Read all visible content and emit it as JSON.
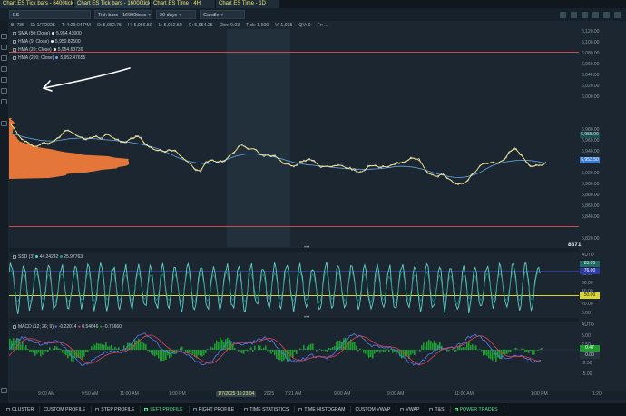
{
  "tabs": [
    {
      "label": "Chart ES Tick bars - 6400ticks"
    },
    {
      "label": "Chart ES Tick bars - 16000ticks"
    },
    {
      "label": "Chart ES Time - 4H"
    },
    {
      "label": "Chart ES Time - 1D"
    }
  ],
  "toolbar": {
    "symbol": "ES",
    "bar_type": "Tick bars - 16000ticks",
    "range": "20 days",
    "style": "Candle"
  },
  "info": {
    "bar_no": "B: 735",
    "date": "D: 1/7/2025",
    "time": "T: 4:23:04 PM",
    "open": "O: 5,952.75",
    "high": "H: 5,956.50",
    "low": "L: 5,952.50",
    "close": "C: 5,954.25",
    "change": "Chn: 0.03",
    "ticks": "Tick: 1,600",
    "volume": "V: 1,935",
    "qv": "QV: 0",
    "fr": "Fr: ..."
  },
  "legend": [
    {
      "name": "SMA (50;Close)",
      "value": "5,954.43000",
      "color": "#e7ecef"
    },
    {
      "name": "HMA (9; Close)",
      "value": "5,950.82500",
      "color": "#e7ecef"
    },
    {
      "name": "HMA (20; Close)",
      "value": "5,954.63739",
      "color": "#e7ecef"
    },
    {
      "name": "HMA (200; Close)",
      "value": "5,952.47655",
      "color": "#6aa7e6"
    }
  ],
  "price_axis": {
    "ticks": [
      "6,120.00",
      "6,100.00",
      "6,080.00",
      "6,060.00",
      "6,040.00",
      "6,020.00",
      "6,000.00",
      "5,980.00",
      "5,960.00",
      "5,940.00",
      "5,920.00",
      "5,900.00",
      "5,880.00",
      "5,860.00",
      "5,840.00",
      "5,820.00"
    ],
    "label_top": "5,955.00",
    "label_bottom": "5,953.50"
  },
  "watermark": "8871",
  "ssd": {
    "name": "SSD (3)",
    "v1": "44.24242",
    "v2": "25.97763",
    "ticks": [
      "AUTO",
      "80.00",
      "60.00",
      "40.00",
      "20.00",
      "0.00"
    ],
    "label_a": "83.05",
    "label_b": "76.00",
    "label_c": "50.00"
  },
  "macd": {
    "name": "MACD (12; 26; 9)",
    "v1": "-0.22014",
    "v2": "0.54646",
    "v3": "-0.76660",
    "ticks": [
      "AUTO",
      "5.00",
      "2.50",
      "0.00",
      "-2.50",
      "-5.00"
    ],
    "label_a": "0.47",
    "label_b": "0.00"
  },
  "time_axis": {
    "labels": [
      "9:00 AM",
      "9:50 AM",
      "11:00 AM",
      "1:00 PM",
      "1/7/2025 16:23:04",
      "7:21 AM",
      "9:00 AM",
      "9:00 AM",
      "11:00 AM",
      "1:00 PM",
      "1:20"
    ],
    "extra": "2025"
  },
  "bottom": [
    {
      "label": "CLUSTER",
      "on": false
    },
    {
      "label": "CUSTOM PROFILE",
      "on": false
    },
    {
      "label": "STEP PROFILE",
      "on": false
    },
    {
      "label": "LEFT PROFILE",
      "on": true
    },
    {
      "label": "RIGHT PROFILE",
      "on": false
    },
    {
      "label": "TIME STATISTICS",
      "on": false
    },
    {
      "label": "TIME HISTOGRAM",
      "on": false
    },
    {
      "label": "CUSTOM VWAP",
      "on": false
    },
    {
      "label": "VWAP",
      "on": false
    },
    {
      "label": "T&S",
      "on": false
    },
    {
      "label": "POWER TRADES",
      "on": true
    }
  ]
}
